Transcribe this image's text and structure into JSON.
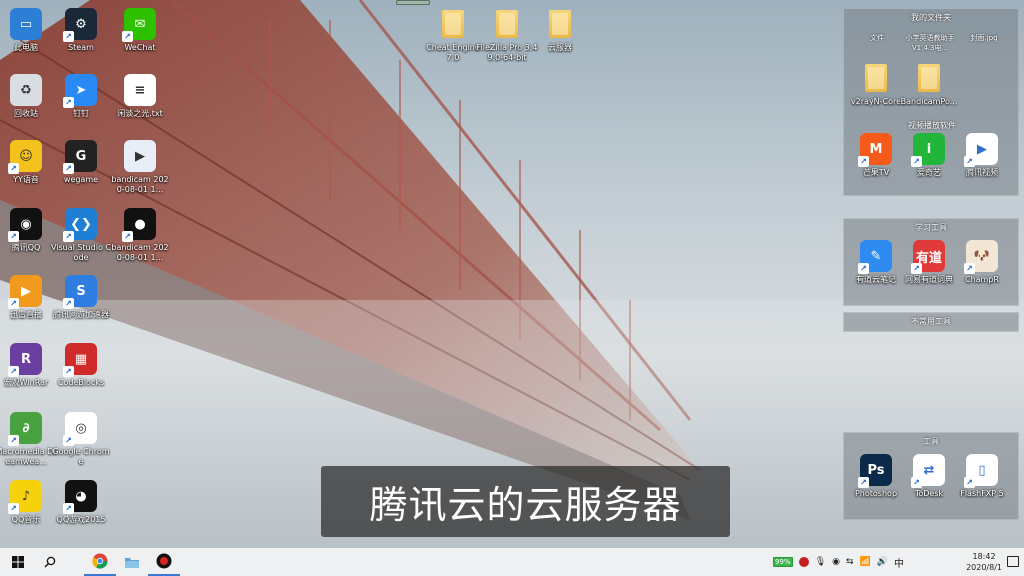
{
  "subtitle": "腾讯云的云服务器",
  "desktop_icons": [
    {
      "name": "this-pc",
      "label": "此电脑",
      "icon": "pc-icon",
      "color": "#2d7fd6",
      "glyph": "▭"
    },
    {
      "name": "steam",
      "label": "Steam",
      "icon": "steam-icon",
      "color": "#1b2838",
      "glyph": "⚙"
    },
    {
      "name": "wechat",
      "label": "WeChat",
      "icon": "wechat-icon",
      "color": "#2dc100",
      "glyph": "✉"
    },
    {
      "name": "recycle-bin",
      "label": "回收站",
      "icon": "recycle-bin-icon",
      "color": "#d7dde3",
      "glyph": "♻"
    },
    {
      "name": "dingding",
      "label": "钉钉",
      "icon": "dingtalk-icon",
      "color": "#2a8af5",
      "glyph": "➤"
    },
    {
      "name": "txt-file",
      "label": "闲谈之光.txt",
      "icon": "text-file-icon",
      "color": "#ffffff",
      "glyph": "≡"
    },
    {
      "name": "yy",
      "label": "YY语音",
      "icon": "yy-icon",
      "color": "#f4c21d",
      "glyph": "☺"
    },
    {
      "name": "wegame",
      "label": "wegame",
      "icon": "wegame-icon",
      "color": "#222222",
      "glyph": "G"
    },
    {
      "name": "bandicam-mp4",
      "label": "bandicam 2020-08-01 1...",
      "icon": "video-file-icon",
      "color": "#e8eef7",
      "glyph": "▶"
    },
    {
      "name": "tencent-qq",
      "label": "腾讯QQ",
      "icon": "qq-icon",
      "color": "#111111",
      "glyph": "◉"
    },
    {
      "name": "vscode",
      "label": "Visual Studio Code",
      "icon": "vscode-icon",
      "color": "#1f7fd4",
      "glyph": "❮❯"
    },
    {
      "name": "bandicam-2",
      "label": "bandicam 2020-08-01 1...",
      "icon": "bandicam-icon",
      "color": "#111111",
      "glyph": "●"
    },
    {
      "name": "tencent-video-app",
      "label": "迅雷直播",
      "icon": "live-icon",
      "color": "#f29a1d",
      "glyph": "▶"
    },
    {
      "name": "tencent-net-accel",
      "label": "腾讯网游加速器",
      "icon": "accelerator-icon",
      "color": "#2f7de0",
      "glyph": "S"
    },
    {
      "name": "winrar",
      "label": "宏观WinRar",
      "icon": "rar-icon",
      "color": "#6b3fa0",
      "glyph": "R"
    },
    {
      "name": "codeblocks",
      "label": "CodeBlocks",
      "icon": "codeblocks-icon",
      "color": "#d02b2b",
      "glyph": "▦"
    },
    {
      "name": "dreamweaver",
      "label": "Macromedia Dreamwea...",
      "icon": "dreamweaver-icon",
      "color": "#48a23f",
      "glyph": "∂"
    },
    {
      "name": "chrome",
      "label": "Google Chrome",
      "icon": "chrome-icon",
      "color": "#ffffff",
      "glyph": "◎"
    },
    {
      "name": "qq-music",
      "label": "QQ音乐",
      "icon": "qq-music-icon",
      "color": "#f5d20c",
      "glyph": "♪"
    },
    {
      "name": "qq-game",
      "label": "QQ游戏2015",
      "icon": "qq-game-icon",
      "color": "#111111",
      "glyph": "◕"
    }
  ],
  "top_folders": [
    {
      "name": "folder-cheat-engine",
      "label": "Cheat Engine 7.0"
    },
    {
      "name": "folder-filezilla",
      "label": "FileZilla Pro 3.49.0-64-bit"
    },
    {
      "name": "folder-yunshangji",
      "label": "云服器"
    }
  ],
  "fences": {
    "my_files": {
      "title": "我的文件夹",
      "subs": [
        "文件",
        "小学英语教助手V1.4.3电...",
        "封面.jpg"
      ],
      "items": [
        {
          "name": "folder-v2rayn",
          "label": "v2rayN-Core"
        },
        {
          "name": "folder-bandicampo",
          "label": "BandicamPo..."
        }
      ],
      "section2": "视频播放软件",
      "apps": [
        {
          "name": "mango-tv",
          "label": "芒果TV",
          "icon": "mango-tv-icon",
          "color": "#f55a1b",
          "glyph": "M"
        },
        {
          "name": "iqiyi",
          "label": "爱奇艺",
          "icon": "iqiyi-icon",
          "color": "#21b53a",
          "glyph": "i"
        },
        {
          "name": "tencent-video",
          "label": "腾讯视频",
          "icon": "tencent-video-icon",
          "color": "#ffffff",
          "glyph": "▶"
        }
      ]
    },
    "study": {
      "title": "学习工具",
      "apps": [
        {
          "name": "youdao-note",
          "label": "有道云笔记",
          "icon": "youdao-note-icon",
          "color": "#2f8bf2",
          "glyph": "✎"
        },
        {
          "name": "youdao-dict",
          "label": "网易有道词典",
          "icon": "youdao-dict-icon",
          "color": "#e03a3a",
          "glyph": "有道"
        },
        {
          "name": "champr",
          "label": "ChampR",
          "icon": "champr-icon",
          "color": "#f2e6d6",
          "glyph": "🐶"
        }
      ]
    },
    "rare": {
      "title": "不常用工具"
    },
    "tools": {
      "title": "工具",
      "apps": [
        {
          "name": "photoshop",
          "label": "Photoshop",
          "icon": "photoshop-icon",
          "color": "#0b2a4a",
          "glyph": "Ps"
        },
        {
          "name": "todesk",
          "label": "ToDesk",
          "icon": "todesk-icon",
          "color": "#ffffff",
          "glyph": "⇄"
        },
        {
          "name": "flashfxp",
          "label": "FlashFXP 5",
          "icon": "flashfxp-icon",
          "color": "#ffffff",
          "glyph": "▯"
        }
      ]
    }
  },
  "taskbar": {
    "start_icon": "windows-start-icon",
    "search_icon": "search-icon",
    "apps": [
      "chrome-icon",
      "folder-icon",
      "bandicam-icon"
    ],
    "tray": {
      "battery_label": "99%",
      "lang": "中",
      "time": "18:42",
      "date": "2020/8/1"
    }
  }
}
